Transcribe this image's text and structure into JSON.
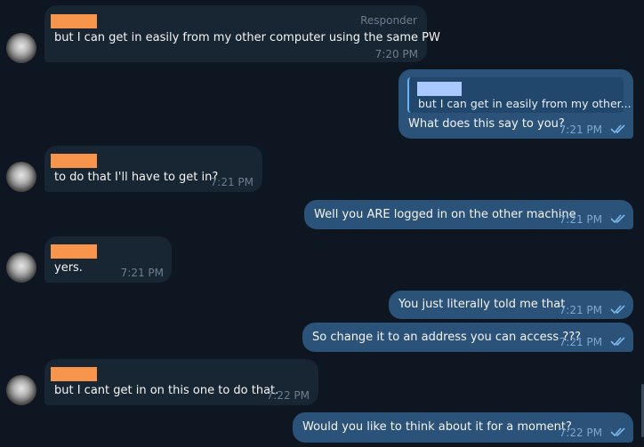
{
  "messages": [
    {
      "id": 1,
      "direction": "in",
      "role": "Responder",
      "text": "but I can get in easily from my other computer using the same PW",
      "time": "7:20 PM"
    },
    {
      "id": 2,
      "direction": "out",
      "quote_text": "but I can get in easily from my other...",
      "text": "What does this say to you?",
      "time": "7:21 PM"
    },
    {
      "id": 3,
      "direction": "in",
      "text": "to do that I'll have to get in?",
      "time": "7:21 PM"
    },
    {
      "id": 4,
      "direction": "out",
      "text": "Well you ARE logged in on the other machine",
      "time": "7:21 PM"
    },
    {
      "id": 5,
      "direction": "in",
      "text": "yers.",
      "time": "7:21 PM"
    },
    {
      "id": 6,
      "direction": "out",
      "text": "You just literally told me that",
      "time": "7:21 PM"
    },
    {
      "id": 7,
      "direction": "out",
      "text": "So change it to an address you can access ???",
      "time": "7:21 PM"
    },
    {
      "id": 8,
      "direction": "in",
      "text": "but I cant get in on this one to do that.",
      "time": "7:22 PM"
    },
    {
      "id": 9,
      "direction": "out",
      "text": "Would you like to think about it for a moment?",
      "time": "7:22 PM"
    }
  ],
  "icons": {
    "avatar": "user-avatar-blurred",
    "read_receipt": "double-check-icon"
  },
  "colors": {
    "background": "#0e1621",
    "incoming": "#182533",
    "outgoing": "#2b5278",
    "redaction": "#f7954d",
    "quote_redaction": "#a9c9ff",
    "accent": "#6ab2f2"
  }
}
